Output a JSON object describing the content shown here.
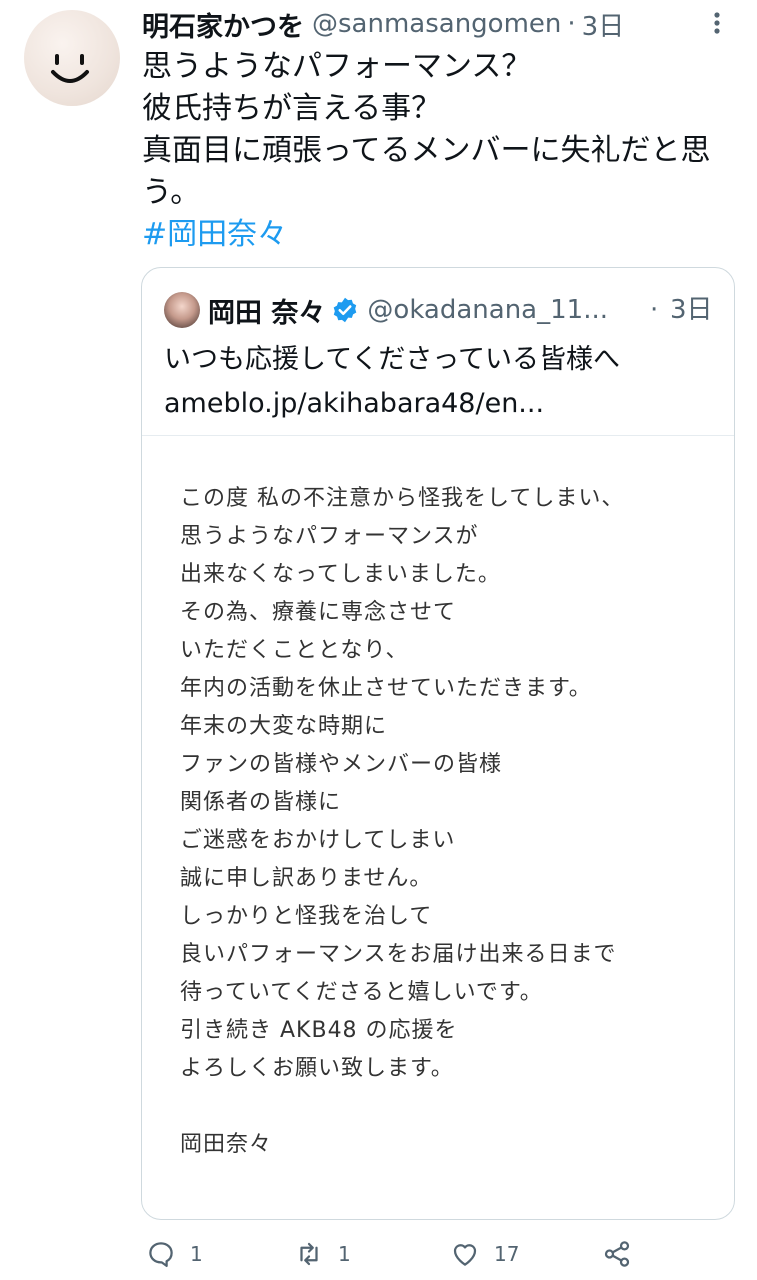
{
  "tweet": {
    "author_name": "明石家かつを",
    "author_handle": "@sanmasangomen",
    "separator": "·",
    "time": "3日",
    "lines": [
      "思うようなパフォーマンス？",
      "彼氏持ちが言える事？",
      "真面目に頑張ってるメンバーに失礼だと思",
      "う。"
    ],
    "hashtag": "#岡田奈々"
  },
  "quote": {
    "author_name": "岡田 奈々",
    "author_handle": "@okadanana_11...",
    "separator": "·",
    "time": "3日",
    "text": "いつも応援してくださっている皆様へ",
    "link": "ameblo.jp/akihabara48/en...",
    "notice_lines": [
      "この度 私の不注意から怪我をしてしまい、",
      "思うようなパフォーマンスが",
      "出来なくなってしまいました。",
      "その為、療養に専念させて",
      "いただくこととなり、",
      "年内の活動を休止させていただきます。",
      "年末の大変な時期に",
      "ファンの皆様やメンバーの皆様",
      "関係者の皆様に",
      "ご迷惑をおかけしてしまい",
      "誠に申し訳ありません。",
      "しっかりと怪我を治して",
      "良いパフォーマンスをお届け出来る日まで",
      "待っていてくださると嬉しいです。",
      "引き続き AKB48 の応援を",
      "よろしくお願い致します。",
      "",
      "岡田奈々"
    ]
  },
  "actions": {
    "reply_count": "1",
    "retweet_count": "1",
    "like_count": "17"
  },
  "colors": {
    "link": "#1d9bf0",
    "secondary_text": "#536471",
    "border": "#cfd9de"
  },
  "icons": [
    "more-icon",
    "verified-badge-icon",
    "reply-icon",
    "retweet-icon",
    "like-icon",
    "share-icon"
  ]
}
